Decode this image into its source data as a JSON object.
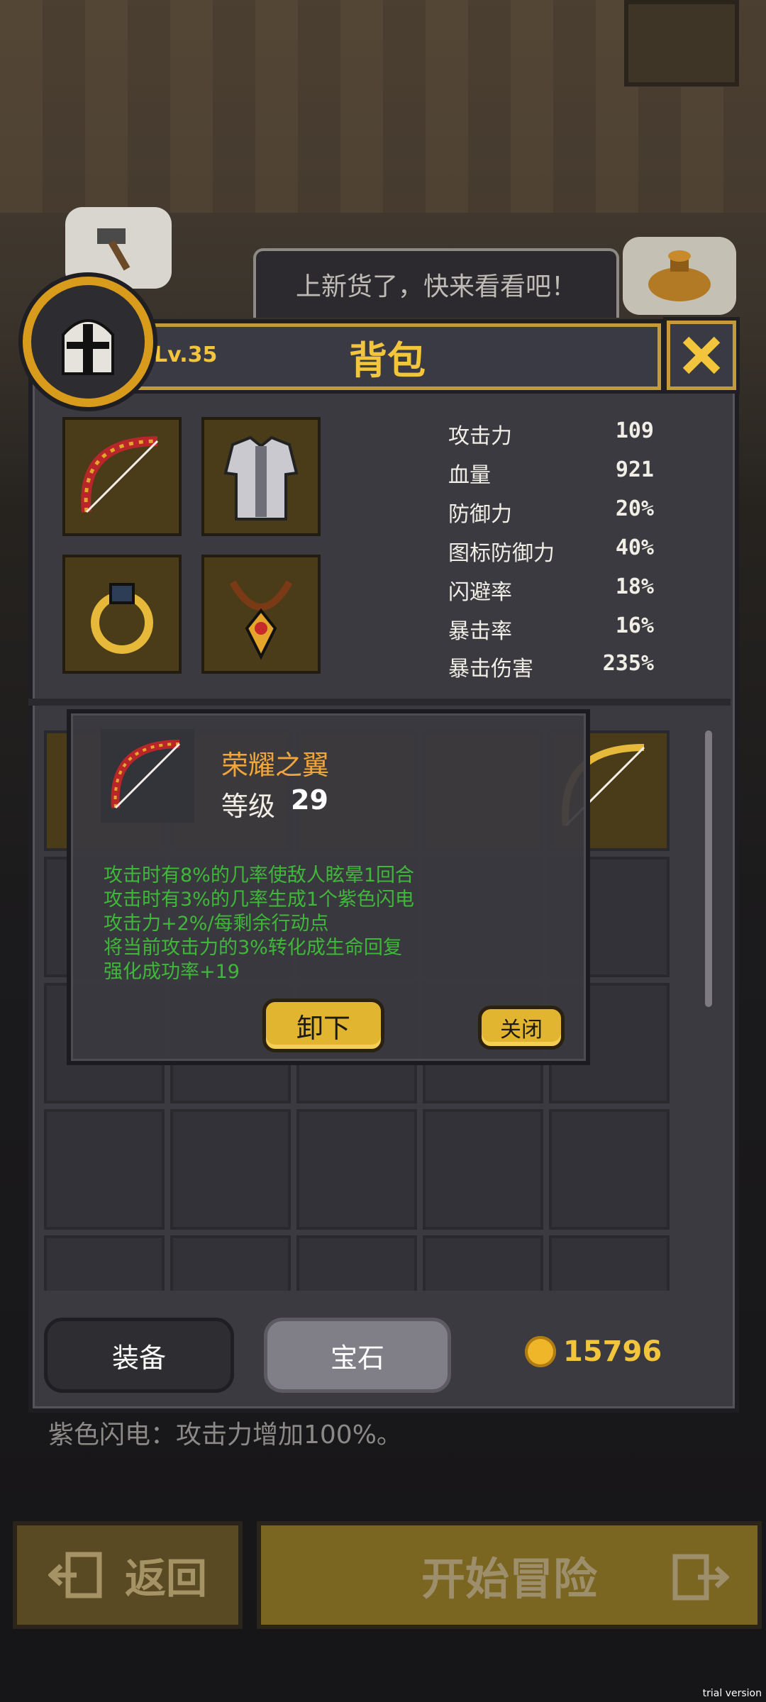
{
  "merchant_bubble": "上新货了，快来看看吧！",
  "panel": {
    "level": "Lv.35",
    "title": "背包"
  },
  "stats": [
    {
      "label": "攻击力",
      "value": "109"
    },
    {
      "label": "血量",
      "value": "921"
    },
    {
      "label": "防御力",
      "value": "20%"
    },
    {
      "label": "图标防御力",
      "value": "40%"
    },
    {
      "label": "闪避率",
      "value": "18%"
    },
    {
      "label": "暴击率",
      "value": "16%"
    },
    {
      "label": "暴击伤害",
      "value": "235%"
    }
  ],
  "item_popup": {
    "name": "荣耀之翼",
    "level_label": "等级",
    "level_value": "29",
    "effects": [
      "攻击时有8%的几率使敌人眩晕1回合",
      "攻击时有3%的几率生成1个紫色闪电",
      "攻击力+2%/每剩余行动点",
      "将当前攻击力的3%转化成生命回复",
      "强化成功率+19"
    ],
    "unequip_label": "卸下",
    "close_label": "关闭"
  },
  "tabs": {
    "equipment": "装备",
    "gems": "宝石"
  },
  "coins": "15796",
  "status_text": "紫色闪电：攻击力增加100%。",
  "bottom": {
    "back_label": "返回",
    "start_label": "开始冒险"
  },
  "watermark": "trial version"
}
